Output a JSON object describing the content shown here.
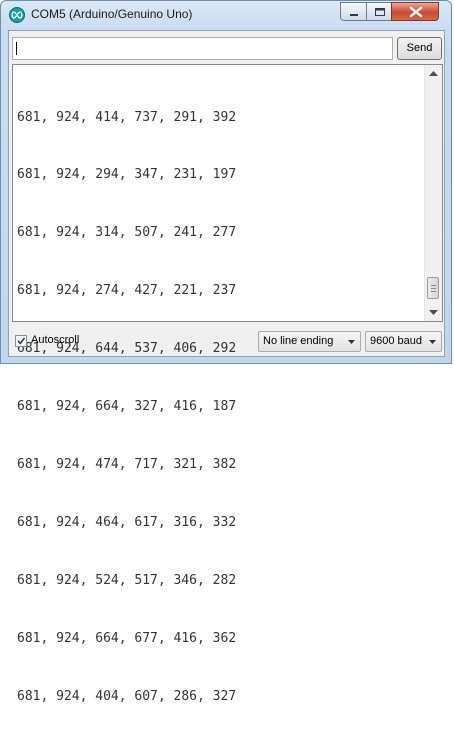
{
  "window": {
    "title": "COM5 (Arduino/Genuino Uno)"
  },
  "send_bar": {
    "input_value": "",
    "send_label": "Send"
  },
  "output": {
    "lines": [
      "681, 924, 414, 737, 291, 392",
      "681, 924, 294, 347, 231, 197",
      "681, 924, 314, 507, 241, 277",
      "681, 924, 274, 427, 221, 237",
      "681, 924, 644, 537, 406, 292",
      "681, 924, 664, 327, 416, 187",
      "681, 924, 474, 717, 321, 382",
      "681, 924, 464, 617, 316, 332",
      "681, 924, 524, 517, 346, 282",
      "681, 924, 664, 677, 416, 362",
      "681, 924, 404, 607, 286, 327"
    ]
  },
  "footer": {
    "autoscroll_label": "Autoscroll",
    "autoscroll_checked": true,
    "line_ending": "No line ending",
    "baud_rate": "9600 baud"
  },
  "icons": {
    "app": "arduino-infinity-icon",
    "minimize": "minimize-icon",
    "maximize": "maximize-icon",
    "close": "close-icon"
  },
  "colors": {
    "app_icon": "#17a1a5",
    "close_button": "#c94c32"
  }
}
